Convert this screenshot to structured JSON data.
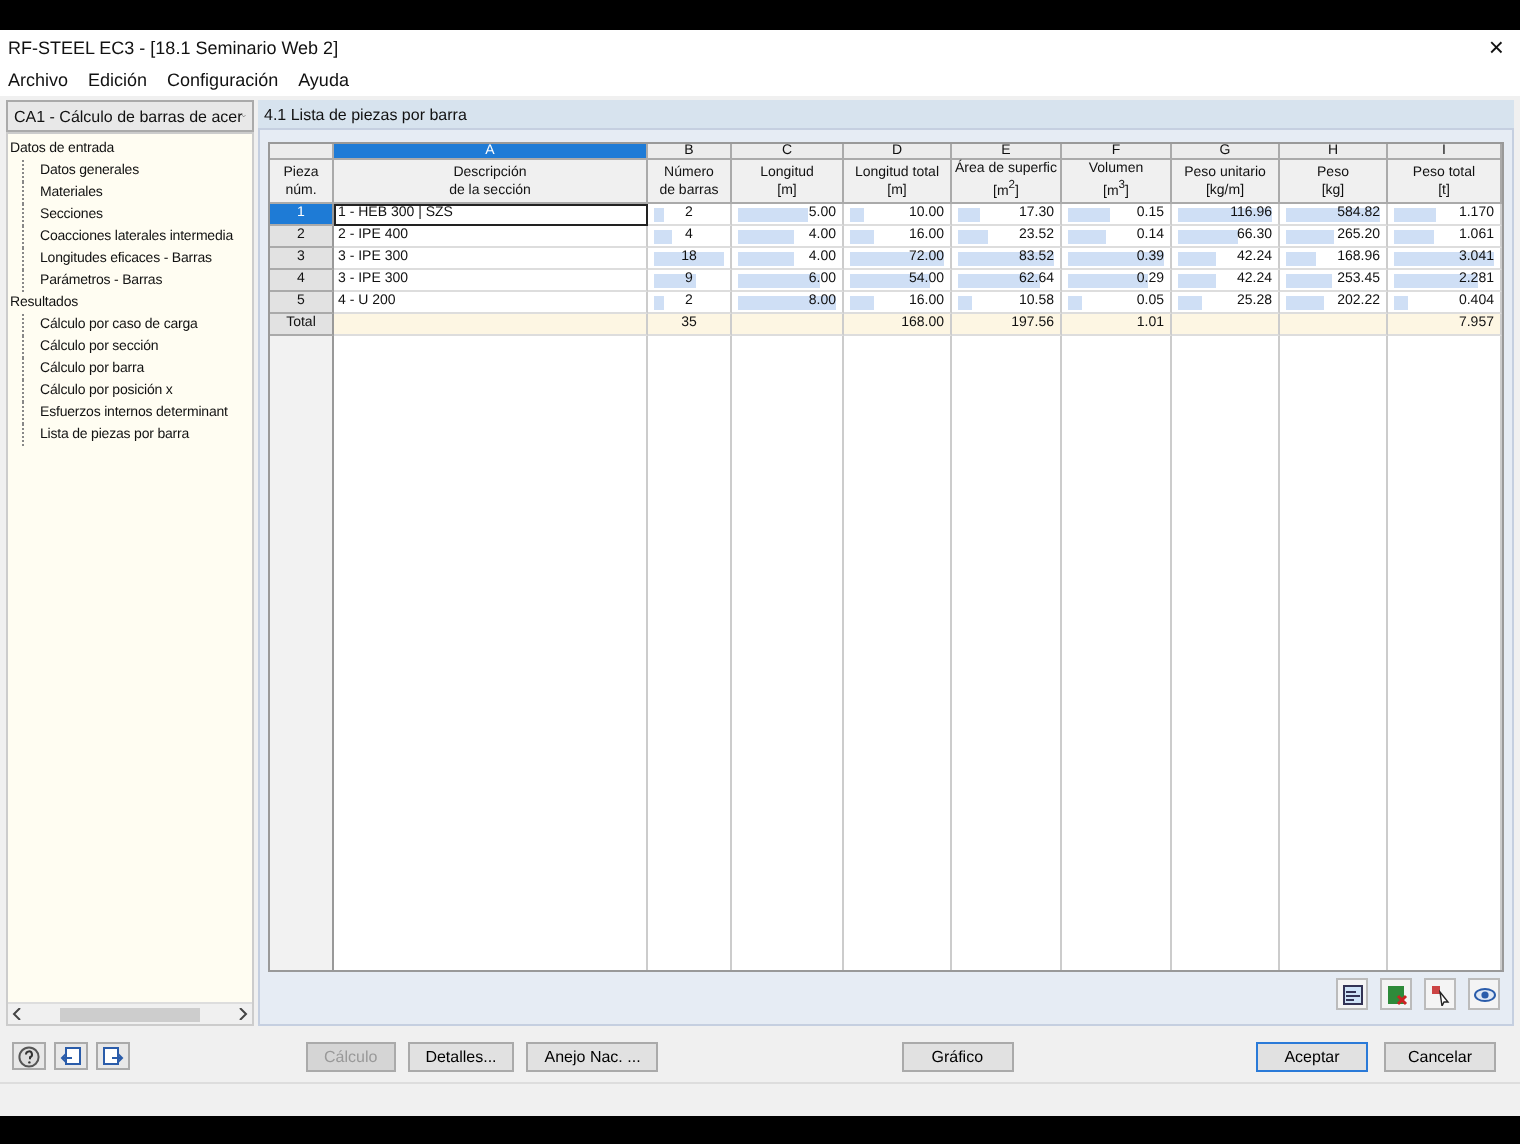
{
  "window": {
    "title": "RF-STEEL EC3 - [18.1 Seminario Web 2]",
    "close": "×"
  },
  "menu": [
    "Archivo",
    "Edición",
    "Configuración",
    "Ayuda"
  ],
  "case_selector": {
    "value": "CA1 - Cálculo de barras de acer"
  },
  "sidebar": {
    "items": [
      {
        "label": "Datos de entrada",
        "children": [
          {
            "label": "Datos generales"
          },
          {
            "label": "Materiales"
          },
          {
            "label": "Secciones"
          },
          {
            "label": "Coacciones laterales intermedia"
          },
          {
            "label": "Longitudes eficaces - Barras"
          },
          {
            "label": "Parámetros - Barras"
          }
        ]
      },
      {
        "label": "Resultados",
        "children": [
          {
            "label": "Cálculo por caso de carga"
          },
          {
            "label": "Cálculo por sección"
          },
          {
            "label": "Cálculo por barra"
          },
          {
            "label": "Cálculo por posición x"
          },
          {
            "label": "Esfuerzos internos determinant"
          },
          {
            "label": "Lista de piezas por barra"
          }
        ]
      }
    ]
  },
  "panel": {
    "title": "4.1 Lista de piezas por barra"
  },
  "table": {
    "row_header": [
      "Pieza",
      "núm."
    ],
    "columns": [
      {
        "letter": "A",
        "lines": [
          "Descripción",
          "de la sección"
        ],
        "selected": true
      },
      {
        "letter": "B",
        "lines": [
          "Número",
          "de barras"
        ],
        "selected": false
      },
      {
        "letter": "C",
        "lines": [
          "Longitud",
          "[m]"
        ],
        "selected": false
      },
      {
        "letter": "D",
        "lines": [
          "Longitud total",
          "[m]"
        ],
        "selected": false
      },
      {
        "letter": "E",
        "lines": [
          "Área de superfic",
          "[m$^{2}$]"
        ],
        "selected": false
      },
      {
        "letter": "F",
        "lines": [
          "Volumen",
          "[m$^{3}$]"
        ],
        "selected": false
      },
      {
        "letter": "G",
        "lines": [
          "Peso unitario",
          "[kg/m]"
        ],
        "selected": false
      },
      {
        "letter": "H",
        "lines": [
          "Peso",
          "[kg]"
        ],
        "selected": false
      },
      {
        "letter": "I",
        "lines": [
          "Peso total",
          "[t]"
        ],
        "selected": false
      }
    ],
    "rows": [
      {
        "num": "1",
        "selected": true,
        "cells": [
          {
            "text": "1 - HEB 300 | SZS"
          },
          {
            "text": "2",
            "level": 0.11
          },
          {
            "text": "5.00",
            "level": 0.63
          },
          {
            "text": "10.00",
            "level": 0.14
          },
          {
            "text": "17.30",
            "level": 0.21
          },
          {
            "text": "0.15",
            "level": 0.38
          },
          {
            "text": "116.96",
            "level": 1
          },
          {
            "text": "584.82",
            "level": 1
          },
          {
            "text": "1.170",
            "level": 0.38
          }
        ]
      },
      {
        "num": "2",
        "selected": false,
        "cells": [
          {
            "text": "2 - IPE 400"
          },
          {
            "text": "4",
            "level": 0.22
          },
          {
            "text": "4.00",
            "level": 0.5
          },
          {
            "text": "16.00",
            "level": 0.22
          },
          {
            "text": "23.52",
            "level": 0.28
          },
          {
            "text": "0.14",
            "level": 0.36
          },
          {
            "text": "66.30",
            "level": 0.57
          },
          {
            "text": "265.20",
            "level": 0.45
          },
          {
            "text": "1.061",
            "level": 0.35
          }
        ]
      },
      {
        "num": "3",
        "selected": false,
        "cells": [
          {
            "text": "3 - IPE 300"
          },
          {
            "text": "18",
            "level": 1
          },
          {
            "text": "4.00",
            "level": 0.5
          },
          {
            "text": "72.00",
            "level": 1
          },
          {
            "text": "83.52",
            "level": 1
          },
          {
            "text": "0.39",
            "level": 1
          },
          {
            "text": "42.24",
            "level": 0.36
          },
          {
            "text": "168.96",
            "level": 0.29
          },
          {
            "text": "3.041",
            "level": 1
          }
        ]
      },
      {
        "num": "4",
        "selected": false,
        "cells": [
          {
            "text": "3 - IPE 300"
          },
          {
            "text": "9",
            "level": 0.5
          },
          {
            "text": "6.00",
            "level": 0.75
          },
          {
            "text": "54.00",
            "level": 0.75
          },
          {
            "text": "62.64",
            "level": 0.75
          },
          {
            "text": "0.29",
            "level": 0.74
          },
          {
            "text": "42.24",
            "level": 0.36
          },
          {
            "text": "253.45",
            "level": 0.43
          },
          {
            "text": "2.281",
            "level": 0.75
          }
        ]
      },
      {
        "num": "5",
        "selected": false,
        "cells": [
          {
            "text": "4 - U 200"
          },
          {
            "text": "2",
            "level": 0.11
          },
          {
            "text": "8.00",
            "level": 1
          },
          {
            "text": "16.00",
            "level": 0.22
          },
          {
            "text": "10.58",
            "level": 0.13
          },
          {
            "text": "0.05",
            "level": 0.13
          },
          {
            "text": "25.28",
            "level": 0.22
          },
          {
            "text": "202.22",
            "level": 0.35
          },
          {
            "text": "0.404",
            "level": 0.13
          }
        ]
      }
    ],
    "total": {
      "label": "Total",
      "cells": [
        "",
        "35",
        "",
        "168.00",
        "197.56",
        "1.01",
        "",
        "",
        "7.957"
      ]
    }
  },
  "buttons": [
    {
      "label": "Cálculo",
      "disabled": true,
      "default": false
    },
    {
      "label": "Detalles...",
      "disabled": false,
      "default": false
    },
    {
      "label": "Anejo Nac. ...",
      "disabled": false,
      "default": false
    },
    {
      "label": "Gráfico",
      "disabled": false,
      "default": false
    },
    {
      "label": "Aceptar",
      "disabled": false,
      "default": true
    },
    {
      "label": "Cancelar",
      "disabled": false,
      "default": false
    }
  ]
}
